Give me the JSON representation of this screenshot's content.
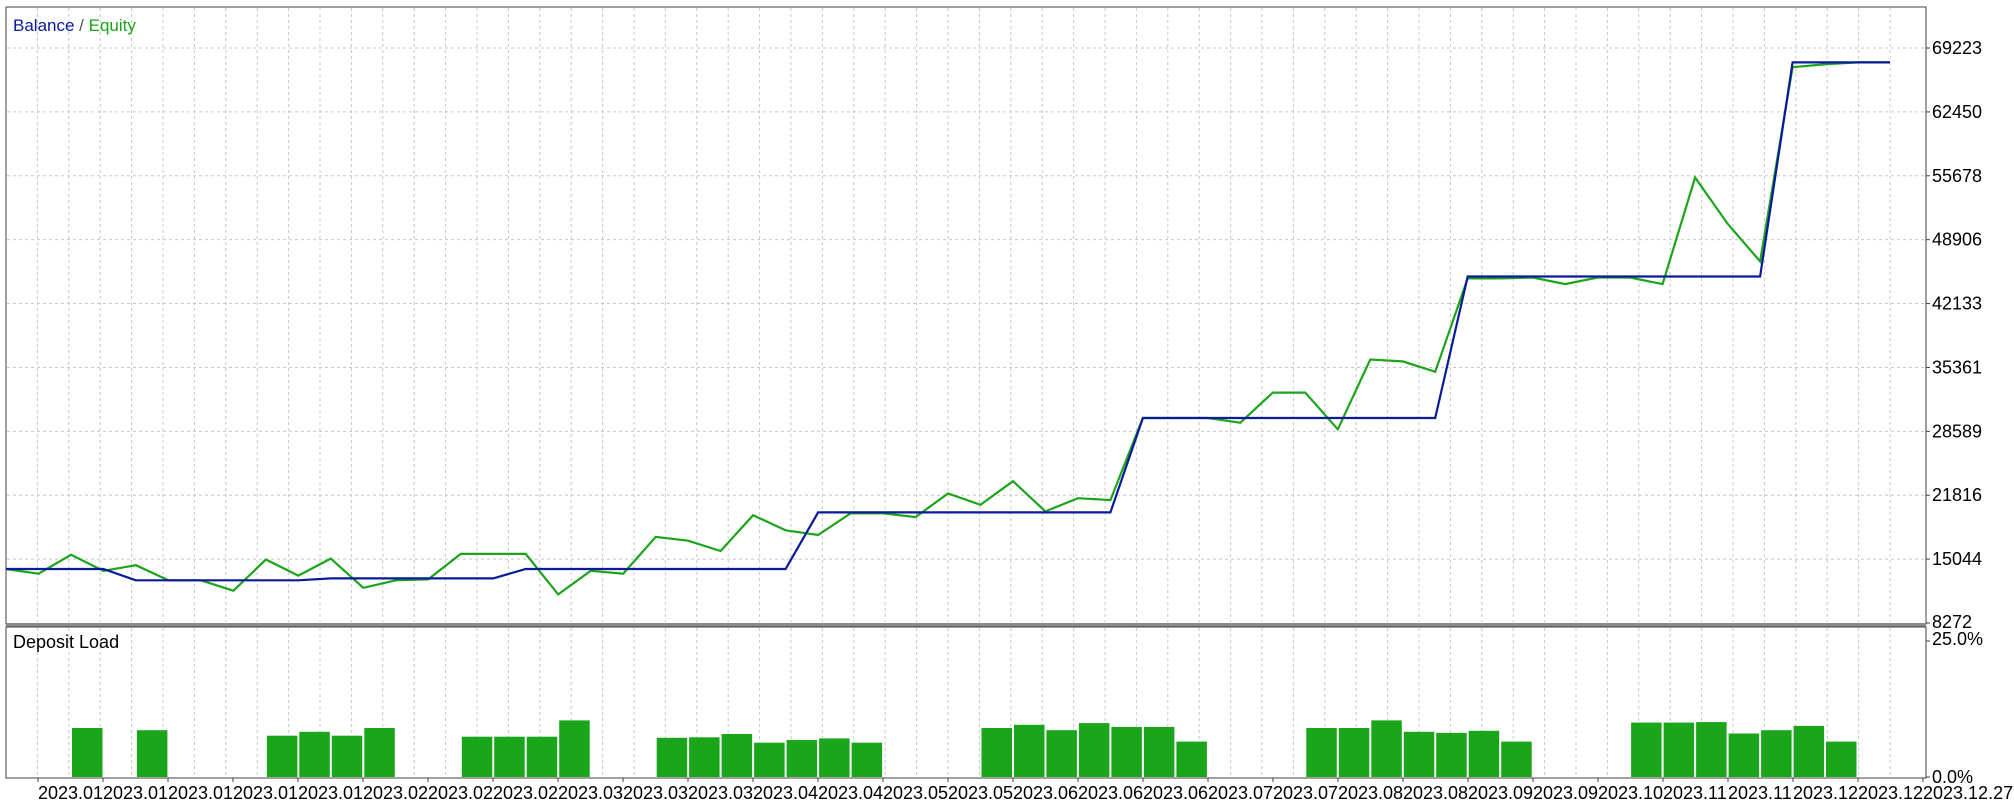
{
  "colors": {
    "balance": "#0a1a9a",
    "equity": "#1aa51a",
    "bar": "#1aa51a",
    "grid": "#c8c8c8",
    "frame": "#404040"
  },
  "legend": {
    "balance": "Balance",
    "separator": " / ",
    "equity": "Equity"
  },
  "deposit_panel": {
    "label": "Deposit Load",
    "top_tick": "25.0%",
    "bottom_tick": "0.0%"
  },
  "chart_data": [
    {
      "type": "line",
      "grid": true,
      "y_ticks": [
        "69223",
        "62450",
        "55678",
        "48906",
        "42133",
        "35361",
        "28589",
        "21816",
        "15044",
        "8272"
      ],
      "ylim": [
        8272,
        69223
      ],
      "series": [
        {
          "name": "Balance",
          "values": [
            14000,
            14000,
            14000,
            14000,
            12800,
            12800,
            12800,
            12800,
            12800,
            12800,
            13000,
            13000,
            13000,
            13000,
            13000,
            13000,
            14000,
            14000,
            14000,
            14000,
            14000,
            14000,
            14000,
            14000,
            14000,
            20000,
            20000,
            20000,
            20000,
            20000,
            20000,
            20000,
            20000,
            20000,
            20000,
            30000,
            30000,
            30000,
            30000,
            30000,
            30000,
            30000,
            30000,
            30000,
            30000,
            45000,
            45000,
            45000,
            45000,
            45000,
            45000,
            45000,
            45000,
            45000,
            45000,
            67700,
            67700,
            67700,
            67700
          ]
        },
        {
          "name": "Equity",
          "values": [
            14000,
            13500,
            15500,
            13800,
            14400,
            12800,
            12800,
            11700,
            15000,
            13300,
            15100,
            12000,
            12800,
            12900,
            15600,
            15600,
            15600,
            11300,
            13800,
            13500,
            17400,
            17000,
            15900,
            19700,
            18100,
            17600,
            19900,
            19900,
            19500,
            22000,
            20800,
            23300,
            20100,
            21500,
            21300,
            30000,
            30000,
            30000,
            29500,
            32700,
            32700,
            28800,
            36200,
            36000,
            34900,
            44800,
            44800,
            44900,
            44200,
            44900,
            44900,
            44200,
            55500,
            50600,
            46600,
            67200,
            67500,
            67700,
            67700
          ]
        }
      ]
    },
    {
      "type": "bar",
      "title": "Deposit Load",
      "ylim": [
        0,
        25
      ],
      "y_ticks": [
        "25.0%",
        "0.0%"
      ],
      "x_tick_labels": [
        "2023.01",
        "2023.01",
        "2023.01",
        "2023.01",
        "2023.01",
        "2023.02",
        "2023.02",
        "2023.02",
        "2023.03",
        "2023.03",
        "2023.03",
        "2023.04",
        "2023.04",
        "2023.05",
        "2023.05",
        "2023.06",
        "2023.06",
        "2023.06",
        "2023.07",
        "2023.07",
        "2023.08",
        "2023.08",
        "2023.09",
        "2023.09",
        "2023.10",
        "2023.11",
        "2023.11",
        "2023.12",
        "2023.12",
        "2023.12.27"
      ],
      "values": [
        0,
        0,
        9.0,
        0,
        8.6,
        0,
        0,
        0,
        7.6,
        8.3,
        7.6,
        9.0,
        0,
        0,
        7.4,
        7.4,
        7.4,
        10.4,
        0,
        0,
        7.2,
        7.3,
        7.9,
        6.3,
        6.8,
        7.1,
        6.3,
        0,
        0,
        0,
        9.0,
        9.6,
        8.6,
        9.9,
        9.2,
        9.2,
        6.5,
        0,
        0,
        0,
        9.0,
        9.0,
        10.4,
        8.3,
        8.1,
        8.5,
        6.5,
        0,
        0,
        0,
        10.0,
        10.0,
        10.1,
        8.0,
        8.6,
        9.4,
        6.5,
        0
      ]
    }
  ]
}
